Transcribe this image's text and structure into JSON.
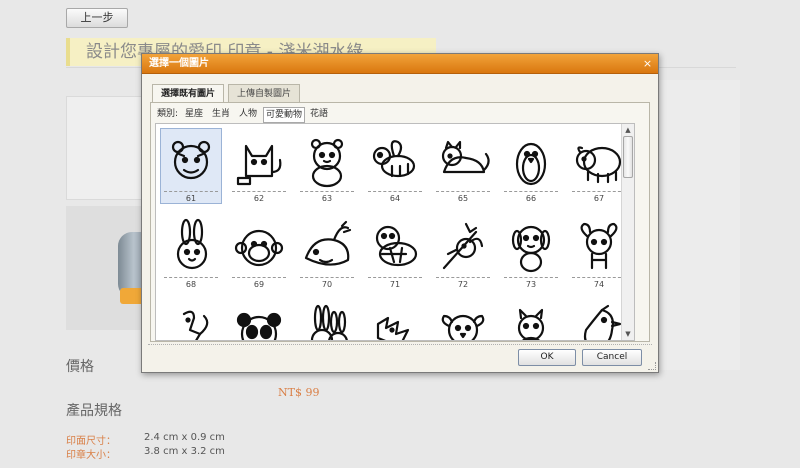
{
  "page": {
    "back_button": "上一步",
    "banner": "設計您專屬的愛印 印章 - 淺米湖水綠",
    "price_label": "價格",
    "price_value": "NT$ 99",
    "spec_title": "產品規格",
    "specs": [
      {
        "key": "印面尺寸：",
        "value": "2.4 cm x 0.9 cm"
      },
      {
        "key": "印章大小：",
        "value": "3.8 cm x 3.2 cm"
      }
    ]
  },
  "dialog": {
    "title": "選擇一個圖片",
    "close_glyph": "×",
    "tabs": [
      {
        "label": "選擇既有圖片",
        "active": true
      },
      {
        "label": "上傳自製圖片",
        "active": false
      }
    ],
    "category_label": "類別:",
    "categories": [
      "星座",
      "生肖",
      "人物",
      "可愛動物",
      "花語"
    ],
    "selected_category": "可愛動物",
    "images": [
      {
        "number": "61",
        "icon": "tiger-icon",
        "selected": true
      },
      {
        "number": "62",
        "icon": "cat-with-bowl-icon"
      },
      {
        "number": "63",
        "icon": "bear-icon"
      },
      {
        "number": "64",
        "icon": "bee-icon"
      },
      {
        "number": "65",
        "icon": "lying-cat-icon"
      },
      {
        "number": "66",
        "icon": "penguin-icon"
      },
      {
        "number": "67",
        "icon": "sheep-icon"
      },
      {
        "number": "68",
        "icon": "rabbit-icon"
      },
      {
        "number": "69",
        "icon": "monkey-icon"
      },
      {
        "number": "70",
        "icon": "whale-icon"
      },
      {
        "number": "71",
        "icon": "turtle-icon"
      },
      {
        "number": "72",
        "icon": "bird-on-branch-icon"
      },
      {
        "number": "73",
        "icon": "dog-icon"
      },
      {
        "number": "74",
        "icon": "ram-icon"
      },
      {
        "number": "",
        "icon": "squirrel-icon"
      },
      {
        "number": "",
        "icon": "panda-icon"
      },
      {
        "number": "",
        "icon": "bunnies-icon"
      },
      {
        "number": "",
        "icon": "dragon-icon"
      },
      {
        "number": "",
        "icon": "chick-icon"
      },
      {
        "number": "",
        "icon": "kitten-icon"
      },
      {
        "number": "",
        "icon": "bird-icon"
      }
    ],
    "ok_button": "OK",
    "cancel_button": "Cancel"
  }
}
